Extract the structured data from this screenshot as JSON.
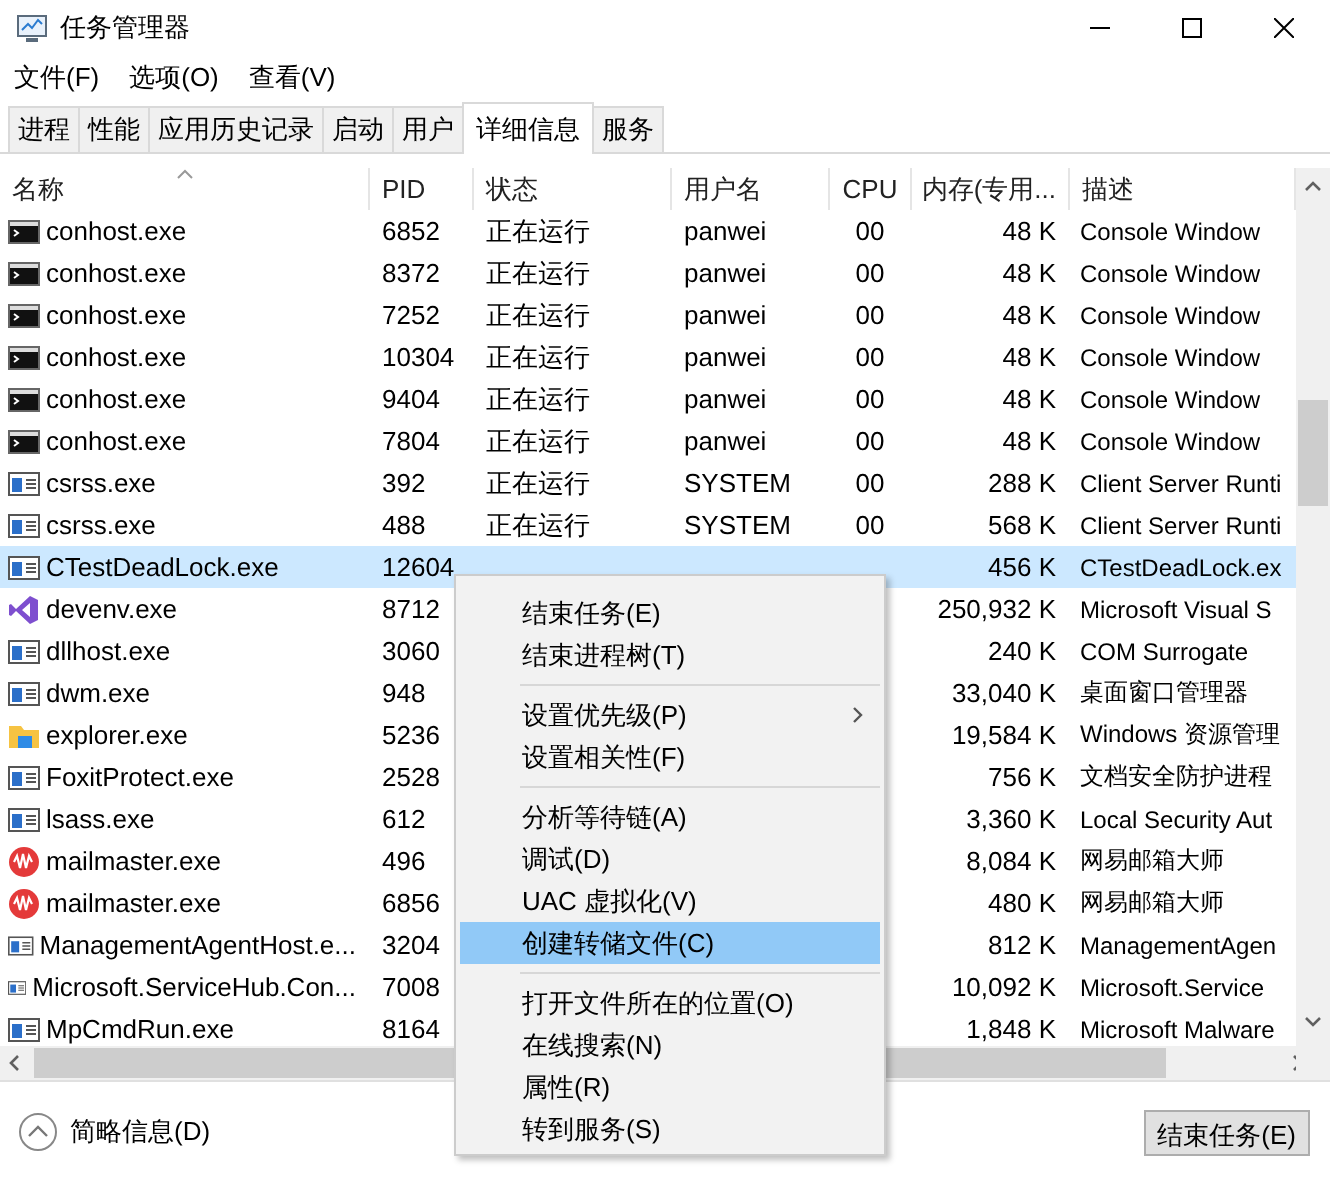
{
  "window": {
    "title": "任务管理器"
  },
  "menu_bar": [
    "文件(F)",
    "选项(O)",
    "查看(V)"
  ],
  "tabs": [
    {
      "label": "进程",
      "selected": false
    },
    {
      "label": "性能",
      "selected": false
    },
    {
      "label": "应用历史记录",
      "selected": false
    },
    {
      "label": "启动",
      "selected": false
    },
    {
      "label": "用户",
      "selected": false
    },
    {
      "label": "详细信息",
      "selected": true
    },
    {
      "label": "服务",
      "selected": false
    }
  ],
  "table": {
    "columns": [
      "名称",
      "PID",
      "状态",
      "用户名",
      "CPU",
      "内存(专用...",
      "描述"
    ],
    "rows": [
      {
        "kind": "console",
        "name": "conhost.exe",
        "pid": "6852",
        "status": "正在运行",
        "user": "panwei",
        "cpu": "00",
        "memory": "48 K",
        "description": "Console Window",
        "selected": false
      },
      {
        "kind": "console",
        "name": "conhost.exe",
        "pid": "8372",
        "status": "正在运行",
        "user": "panwei",
        "cpu": "00",
        "memory": "48 K",
        "description": "Console Window",
        "selected": false
      },
      {
        "kind": "console",
        "name": "conhost.exe",
        "pid": "7252",
        "status": "正在运行",
        "user": "panwei",
        "cpu": "00",
        "memory": "48 K",
        "description": "Console Window",
        "selected": false
      },
      {
        "kind": "console",
        "name": "conhost.exe",
        "pid": "10304",
        "status": "正在运行",
        "user": "panwei",
        "cpu": "00",
        "memory": "48 K",
        "description": "Console Window",
        "selected": false
      },
      {
        "kind": "console",
        "name": "conhost.exe",
        "pid": "9404",
        "status": "正在运行",
        "user": "panwei",
        "cpu": "00",
        "memory": "48 K",
        "description": "Console Window",
        "selected": false
      },
      {
        "kind": "console",
        "name": "conhost.exe",
        "pid": "7804",
        "status": "正在运行",
        "user": "panwei",
        "cpu": "00",
        "memory": "48 K",
        "description": "Console Window",
        "selected": false
      },
      {
        "kind": "app",
        "name": "csrss.exe",
        "pid": "392",
        "status": "正在运行",
        "user": "SYSTEM",
        "cpu": "00",
        "memory": "288 K",
        "description": "Client Server Runti",
        "selected": false
      },
      {
        "kind": "app",
        "name": "csrss.exe",
        "pid": "488",
        "status": "正在运行",
        "user": "SYSTEM",
        "cpu": "00",
        "memory": "568 K",
        "description": "Client Server Runti",
        "selected": false
      },
      {
        "kind": "app",
        "name": "CTestDeadLock.exe",
        "pid": "12604",
        "memory": "456 K",
        "description": "CTestDeadLock.ex",
        "selected": true
      },
      {
        "kind": "studio",
        "name": "devenv.exe",
        "pid": "8712",
        "memory": "250,932 K",
        "description": "Microsoft Visual S",
        "selected": false
      },
      {
        "kind": "app",
        "name": "dllhost.exe",
        "pid": "3060",
        "memory": "240 K",
        "description": "COM Surrogate",
        "selected": false
      },
      {
        "kind": "app",
        "name": "dwm.exe",
        "pid": "948",
        "memory": "33,040 K",
        "description": "桌面窗口管理器",
        "selected": false
      },
      {
        "kind": "folder",
        "name": "explorer.exe",
        "pid": "5236",
        "memory": "19,584 K",
        "description": "Windows 资源管理",
        "selected": false
      },
      {
        "kind": "app",
        "name": "FoxitProtect.exe",
        "pid": "2528",
        "memory": "756 K",
        "description": "文档安全防护进程",
        "selected": false
      },
      {
        "kind": "app",
        "name": "lsass.exe",
        "pid": "612",
        "memory": "3,360 K",
        "description": "Local Security Aut",
        "selected": false
      },
      {
        "kind": "mail",
        "name": "mailmaster.exe",
        "pid": "496",
        "memory": "8,084 K",
        "description": "网易邮箱大师",
        "selected": false
      },
      {
        "kind": "mail",
        "name": "mailmaster.exe",
        "pid": "6856",
        "memory": "480 K",
        "description": "网易邮箱大师",
        "selected": false
      },
      {
        "kind": "app",
        "name": "ManagementAgentHost.e...",
        "pid": "3204",
        "memory": "812 K",
        "description": "ManagementAgen",
        "selected": false
      },
      {
        "kind": "app",
        "name": "Microsoft.ServiceHub.Con...",
        "pid": "7008",
        "memory": "10,092 K",
        "description": "Microsoft.Service",
        "selected": false
      },
      {
        "kind": "app",
        "name": "MpCmdRun.exe",
        "pid": "8164",
        "memory": "1,848 K",
        "description": "Microsoft Malware",
        "selected": false
      }
    ]
  },
  "context_menu": {
    "groups": [
      [
        {
          "label": "结束任务(E)",
          "selected": false,
          "submenu": false
        },
        {
          "label": "结束进程树(T)",
          "selected": false,
          "submenu": false
        }
      ],
      [
        {
          "label": "设置优先级(P)",
          "selected": false,
          "submenu": true
        },
        {
          "label": "设置相关性(F)",
          "selected": false,
          "submenu": false
        }
      ],
      [
        {
          "label": "分析等待链(A)",
          "selected": false,
          "submenu": false
        },
        {
          "label": "调试(D)",
          "selected": false,
          "submenu": false
        },
        {
          "label": "UAC 虚拟化(V)",
          "selected": false,
          "submenu": false
        },
        {
          "label": "创建转储文件(C)",
          "selected": true,
          "submenu": false
        }
      ],
      [
        {
          "label": "打开文件所在的位置(O)",
          "selected": false,
          "submenu": false
        },
        {
          "label": "在线搜索(N)",
          "selected": false,
          "submenu": false
        },
        {
          "label": "属性(R)",
          "selected": false,
          "submenu": false
        },
        {
          "label": "转到服务(S)",
          "selected": false,
          "submenu": false
        }
      ]
    ]
  },
  "footer": {
    "details_toggle": "简略信息(D)",
    "end_task_button": "结束任务(E)"
  }
}
